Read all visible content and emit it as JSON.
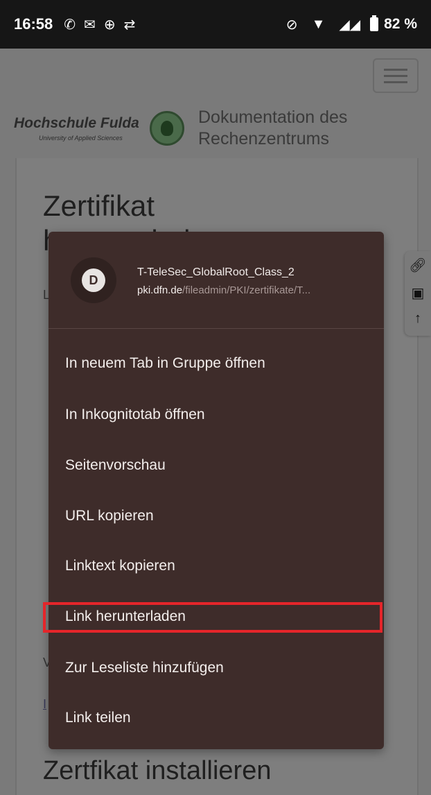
{
  "status_bar": {
    "time": "16:58",
    "battery": "82 %"
  },
  "header": {
    "logo_name": "Hochschule Fulda",
    "logo_subtitle": "University of Applied Sciences",
    "site_title": "Dokumentation des Rechenzentrums"
  },
  "page": {
    "heading": "Zertifikat herunterladen",
    "bg_text_1": "L",
    "bg_text_2": "V",
    "bg_text_3": "I",
    "bottom_heading": "Zertfikat installieren"
  },
  "context_menu": {
    "favicon_letter": "D",
    "link_title": "T-TeleSec_GlobalRoot_Class_2",
    "link_url_domain": "pki.dfn.de",
    "link_url_path": "/fileadmin/PKI/zertifikate/T...",
    "items": [
      {
        "label": "In neuem Tab in Gruppe öffnen"
      },
      {
        "label": "In Inkognitotab öffnen"
      },
      {
        "label": "Seitenvorschau"
      },
      {
        "label": "URL kopieren"
      },
      {
        "label": "Linktext kopieren"
      },
      {
        "label": "Link herunterladen"
      },
      {
        "label": "Zur Leseliste hinzufügen"
      },
      {
        "label": "Link teilen"
      }
    ]
  },
  "icons": {
    "status": [
      "whatsapp-icon",
      "message-icon",
      "sync-icon",
      "transfer-icon",
      "vibrate-off-icon",
      "wifi-icon",
      "signal-icon",
      "battery-icon"
    ],
    "side_tools": [
      "link-icon",
      "pdf-icon",
      "arrow-up-icon"
    ]
  },
  "colors": {
    "menu_background": "#3e2c2a",
    "highlight": "#e5252a"
  }
}
